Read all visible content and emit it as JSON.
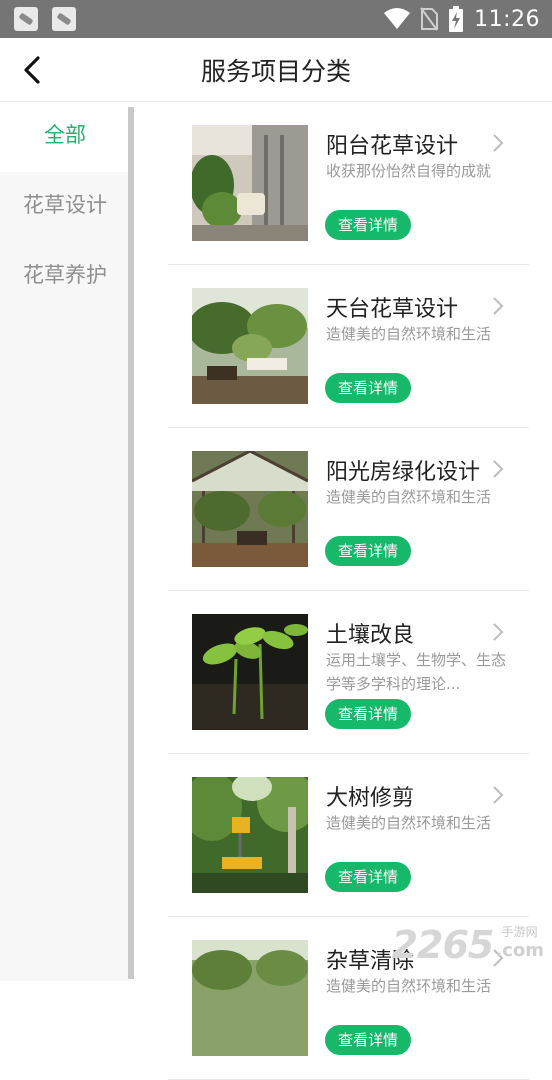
{
  "status_bar": {
    "time": "11:26"
  },
  "header": {
    "title": "服务项目分类"
  },
  "sidebar": {
    "items": [
      {
        "label": "全部"
      },
      {
        "label": "花草设计"
      },
      {
        "label": "花草养护"
      }
    ]
  },
  "services": [
    {
      "title": "阳台花草设计",
      "desc": "收获那份怡然自得的成就",
      "button": "查看详情"
    },
    {
      "title": "天台花草设计",
      "desc": "造健美的自然环境和生活",
      "button": "查看详情"
    },
    {
      "title": "阳光房绿化设计",
      "desc": "造健美的自然环境和生活",
      "button": "查看详情"
    },
    {
      "title": "土壤改良",
      "desc": "运用土壤学、生物学、生态学等多学科的理论...",
      "button": "查看详情"
    },
    {
      "title": "大树修剪",
      "desc": "造健美的自然环境和生活",
      "button": "查看详情"
    },
    {
      "title": "杂草清除",
      "desc": "造健美的自然环境和生活",
      "button": "查看详情"
    }
  ],
  "watermark": {
    "number": "2265",
    "cn": "手游网",
    "com": ".com"
  },
  "colors": {
    "accent": "#16b86a",
    "status_bar": "#757575",
    "sidebar_bg": "#f7f7f7"
  }
}
